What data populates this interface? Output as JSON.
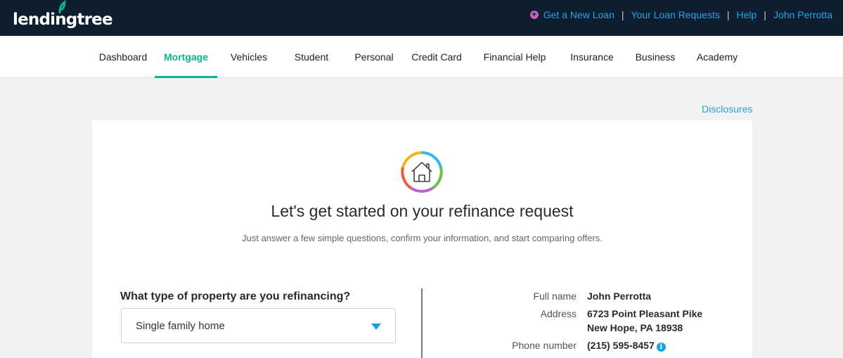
{
  "brand": {
    "name": "lendingtree",
    "accent": "#08b58f",
    "link_color": "#20a5e6",
    "header_bg": "#0f1d31"
  },
  "header": {
    "links": {
      "new_loan": "Get a New Loan",
      "loan_requests": "Your Loan Requests",
      "help": "Help",
      "user": "John Perrotta"
    },
    "separator": "|"
  },
  "nav": {
    "items": [
      "Dashboard",
      "Mortgage",
      "Vehicles",
      "Student",
      "Personal",
      "Credit Card",
      "Financial Help",
      "Insurance",
      "Business",
      "Academy"
    ],
    "active": "Mortgage"
  },
  "disclosures": "Disclosures",
  "card": {
    "icon": "house-icon",
    "title": "Let's get started on your refinance request",
    "subtitle": "Just answer a few simple questions, confirm your information, and start comparing offers."
  },
  "form": {
    "question": "What type of property are you refinancing?",
    "property_type": "Single family home"
  },
  "profile": {
    "full_name_label": "Full name",
    "full_name": "John Perrotta",
    "address_label": "Address",
    "address_line1": "6723 Point Pleasant Pike",
    "address_line2": "New Hope, PA 18938",
    "phone_label": "Phone number",
    "phone": "(215) 595-8457"
  }
}
